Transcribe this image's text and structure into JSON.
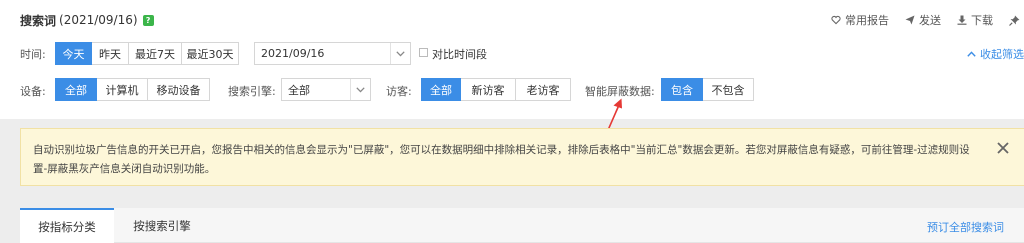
{
  "header": {
    "title": "搜索词",
    "date": "(2021/09/16)",
    "help_glyph": "?",
    "actions": [
      {
        "label": "常用报告",
        "icon": "heart-icon"
      },
      {
        "label": "发送",
        "icon": "send-icon"
      },
      {
        "label": "下载",
        "icon": "download-icon"
      },
      {
        "label": "",
        "icon": "pin-icon"
      }
    ]
  },
  "time_filter": {
    "label": "时间:",
    "options": [
      "今天",
      "昨天",
      "最近7天",
      "最近30天"
    ],
    "selected": "今天",
    "date_value": "2021/09/16",
    "compare_label": "对比时间段",
    "collapse_label": "收起筛选"
  },
  "device_filter": {
    "label": "设备:",
    "options": [
      "全部",
      "计算机",
      "移动设备"
    ],
    "selected": "全部"
  },
  "engine_filter": {
    "label": "搜索引擎:",
    "value": "全部"
  },
  "visitor_filter": {
    "label": "访客:",
    "options": [
      "全部",
      "新访客",
      "老访客"
    ],
    "selected": "全部"
  },
  "smart_block_filter": {
    "label": "智能屏蔽数据:",
    "options": [
      "包含",
      "不包含"
    ],
    "selected": "包含"
  },
  "notice": {
    "text": "自动识别垃圾广告信息的开关已开启，您报告中相关的信息会显示为\"已屏蔽\"，您可以在数据明细中排除相关记录，排除后表格中\"当前汇总\"数据会更新。若您对屏蔽信息有疑惑，可前往管理-过滤规则设置-屏蔽黑灰产信息关闭自动识别功能。"
  },
  "tabs": {
    "items": [
      "按指标分类",
      "按搜索引擎"
    ],
    "selected": "按指标分类",
    "link": "预订全部搜索词"
  },
  "colors": {
    "accent": "#3b8de6",
    "notice_bg": "#fdf7d9",
    "annotation_arrow": "#e53935",
    "help_icon": "#3bb54a"
  }
}
